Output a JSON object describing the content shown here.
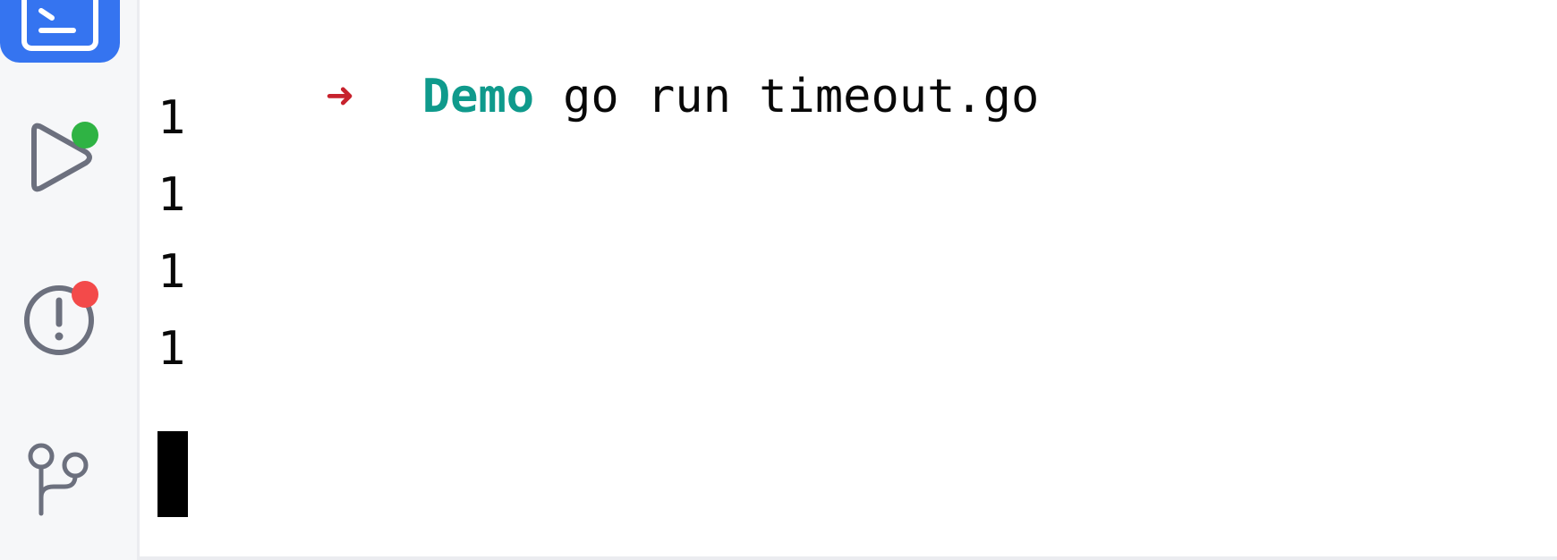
{
  "toolstrip": {
    "items": [
      {
        "icon": "terminal-icon",
        "active": true
      },
      {
        "icon": "run-icon",
        "badge": "green"
      },
      {
        "icon": "problems-icon",
        "badge": "red"
      },
      {
        "icon": "git-branch-icon"
      }
    ]
  },
  "colors": {
    "active_tool": "#3574f0",
    "badge_green": "#2fb344",
    "badge_red": "#f34a4a",
    "prompt_arrow": "#c7222d",
    "prompt_dir": "#0f9a8c"
  },
  "terminal": {
    "prompt": {
      "arrow": "➜",
      "directory": "Demo",
      "command": "go run timeout.go"
    },
    "output": [
      "1",
      "1",
      "1",
      "1"
    ]
  }
}
